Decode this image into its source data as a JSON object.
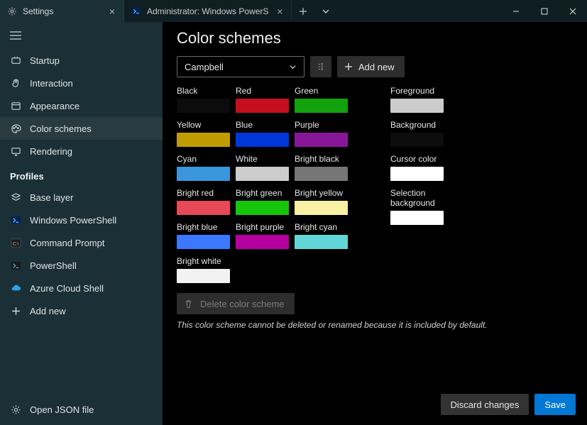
{
  "tabs": [
    {
      "label": "Settings",
      "icon": "gear"
    },
    {
      "label": "Administrator: Windows PowerS",
      "icon": "powershell"
    }
  ],
  "sidebar": {
    "items": [
      {
        "label": "Startup",
        "icon": "power"
      },
      {
        "label": "Interaction",
        "icon": "hand"
      },
      {
        "label": "Appearance",
        "icon": "window"
      },
      {
        "label": "Color schemes",
        "icon": "palette",
        "selected": true
      },
      {
        "label": "Rendering",
        "icon": "monitor"
      }
    ],
    "profiles_title": "Profiles",
    "profiles": [
      {
        "label": "Base layer",
        "icon": "layers"
      },
      {
        "label": "Windows PowerShell",
        "icon": "ps-blue"
      },
      {
        "label": "Command Prompt",
        "icon": "cmd"
      },
      {
        "label": "PowerShell",
        "icon": "ps-dark"
      },
      {
        "label": "Azure Cloud Shell",
        "icon": "azure"
      }
    ],
    "add_new": "Add new",
    "footer": "Open JSON file"
  },
  "page": {
    "title": "Color schemes",
    "selected_scheme": "Campbell",
    "add_new_label": "Add new",
    "delete_label": "Delete color scheme",
    "hint": "This color scheme cannot be deleted or renamed because it is included by default.",
    "swatches_left": [
      [
        {
          "label": "Black",
          "color": "#0c0c0c"
        },
        {
          "label": "Red",
          "color": "#c50f1f"
        },
        {
          "label": "Green",
          "color": "#13a10e"
        }
      ],
      [
        {
          "label": "Yellow",
          "color": "#c19c00"
        },
        {
          "label": "Blue",
          "color": "#0037da"
        },
        {
          "label": "Purple",
          "color": "#881798"
        }
      ],
      [
        {
          "label": "Cyan",
          "color": "#3a96dd"
        },
        {
          "label": "White",
          "color": "#cccccc"
        },
        {
          "label": "Bright black",
          "color": "#767676"
        }
      ],
      [
        {
          "label": "Bright red",
          "color": "#e74856"
        },
        {
          "label": "Bright green",
          "color": "#16c60c"
        },
        {
          "label": "Bright yellow",
          "color": "#f9f1a5"
        }
      ],
      [
        {
          "label": "Bright blue",
          "color": "#3b78ff"
        },
        {
          "label": "Bright purple",
          "color": "#b4009e"
        },
        {
          "label": "Bright cyan",
          "color": "#61d6d6"
        }
      ],
      [
        {
          "label": "Bright white",
          "color": "#f2f2f2"
        }
      ]
    ],
    "swatches_right": [
      {
        "label": "Foreground",
        "color": "#cccccc"
      },
      {
        "label": "Background",
        "color": "#0c0c0c"
      },
      {
        "label": "Cursor color",
        "color": "#ffffff"
      },
      {
        "label": "Selection background",
        "color": "#ffffff"
      }
    ],
    "footer": {
      "discard": "Discard changes",
      "save": "Save"
    }
  }
}
